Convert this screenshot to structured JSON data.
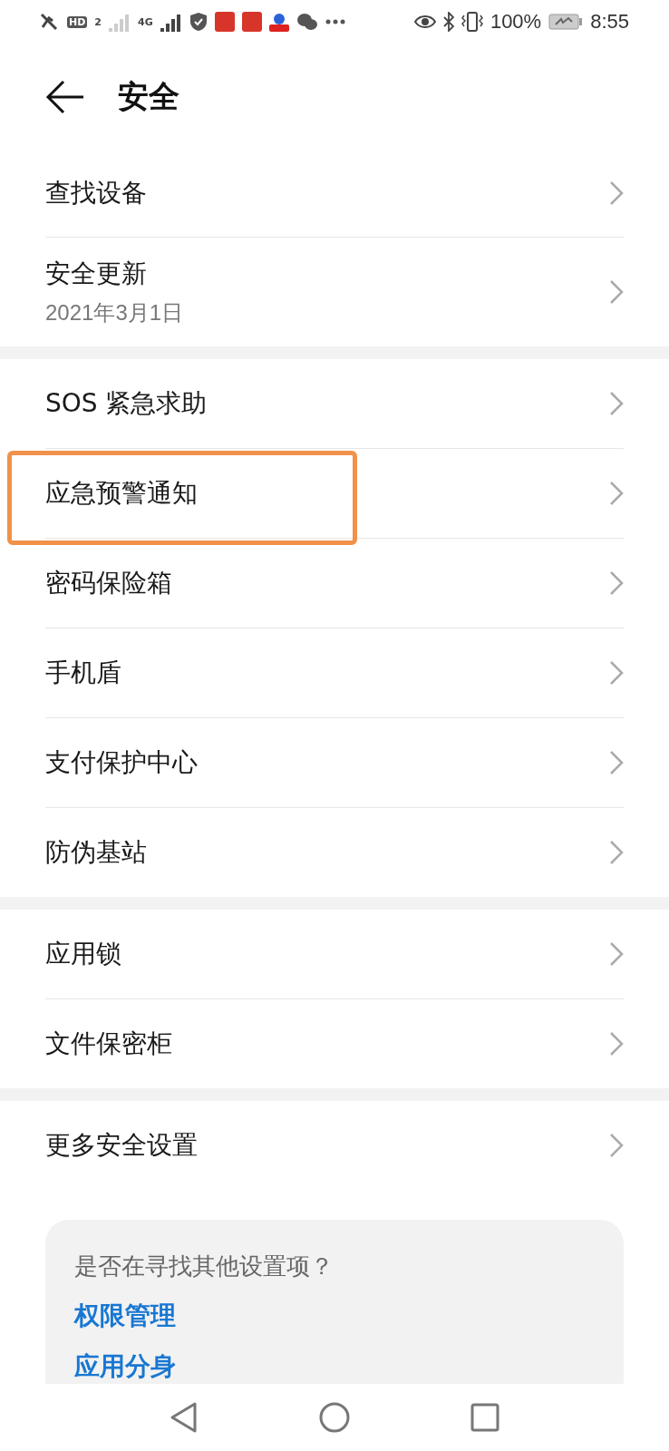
{
  "status_bar": {
    "hd": "HD",
    "sim_slot": "2",
    "network": "4G",
    "battery": "100%",
    "time": "8:55"
  },
  "header": {
    "title": "安全"
  },
  "groups": [
    {
      "items": [
        {
          "label": "查找设备",
          "highlighted": false
        },
        {
          "label": "安全更新",
          "subtitle": "2021年3月1日",
          "highlighted": false
        }
      ]
    },
    {
      "items": [
        {
          "label": "SOS 紧急求助",
          "highlighted": false
        },
        {
          "label": "应急预警通知",
          "highlighted": true
        },
        {
          "label": "密码保险箱",
          "highlighted": false
        },
        {
          "label": "手机盾",
          "highlighted": false
        },
        {
          "label": "支付保护中心",
          "highlighted": false
        },
        {
          "label": "防伪基站",
          "highlighted": false
        }
      ]
    },
    {
      "items": [
        {
          "label": "应用锁",
          "highlighted": false
        },
        {
          "label": "文件保密柜",
          "highlighted": false
        }
      ]
    },
    {
      "items": [
        {
          "label": "更多安全设置",
          "highlighted": false
        }
      ]
    }
  ],
  "suggestions": {
    "question": "是否在寻找其他设置项？",
    "links": [
      "权限管理",
      "应用分身"
    ]
  }
}
